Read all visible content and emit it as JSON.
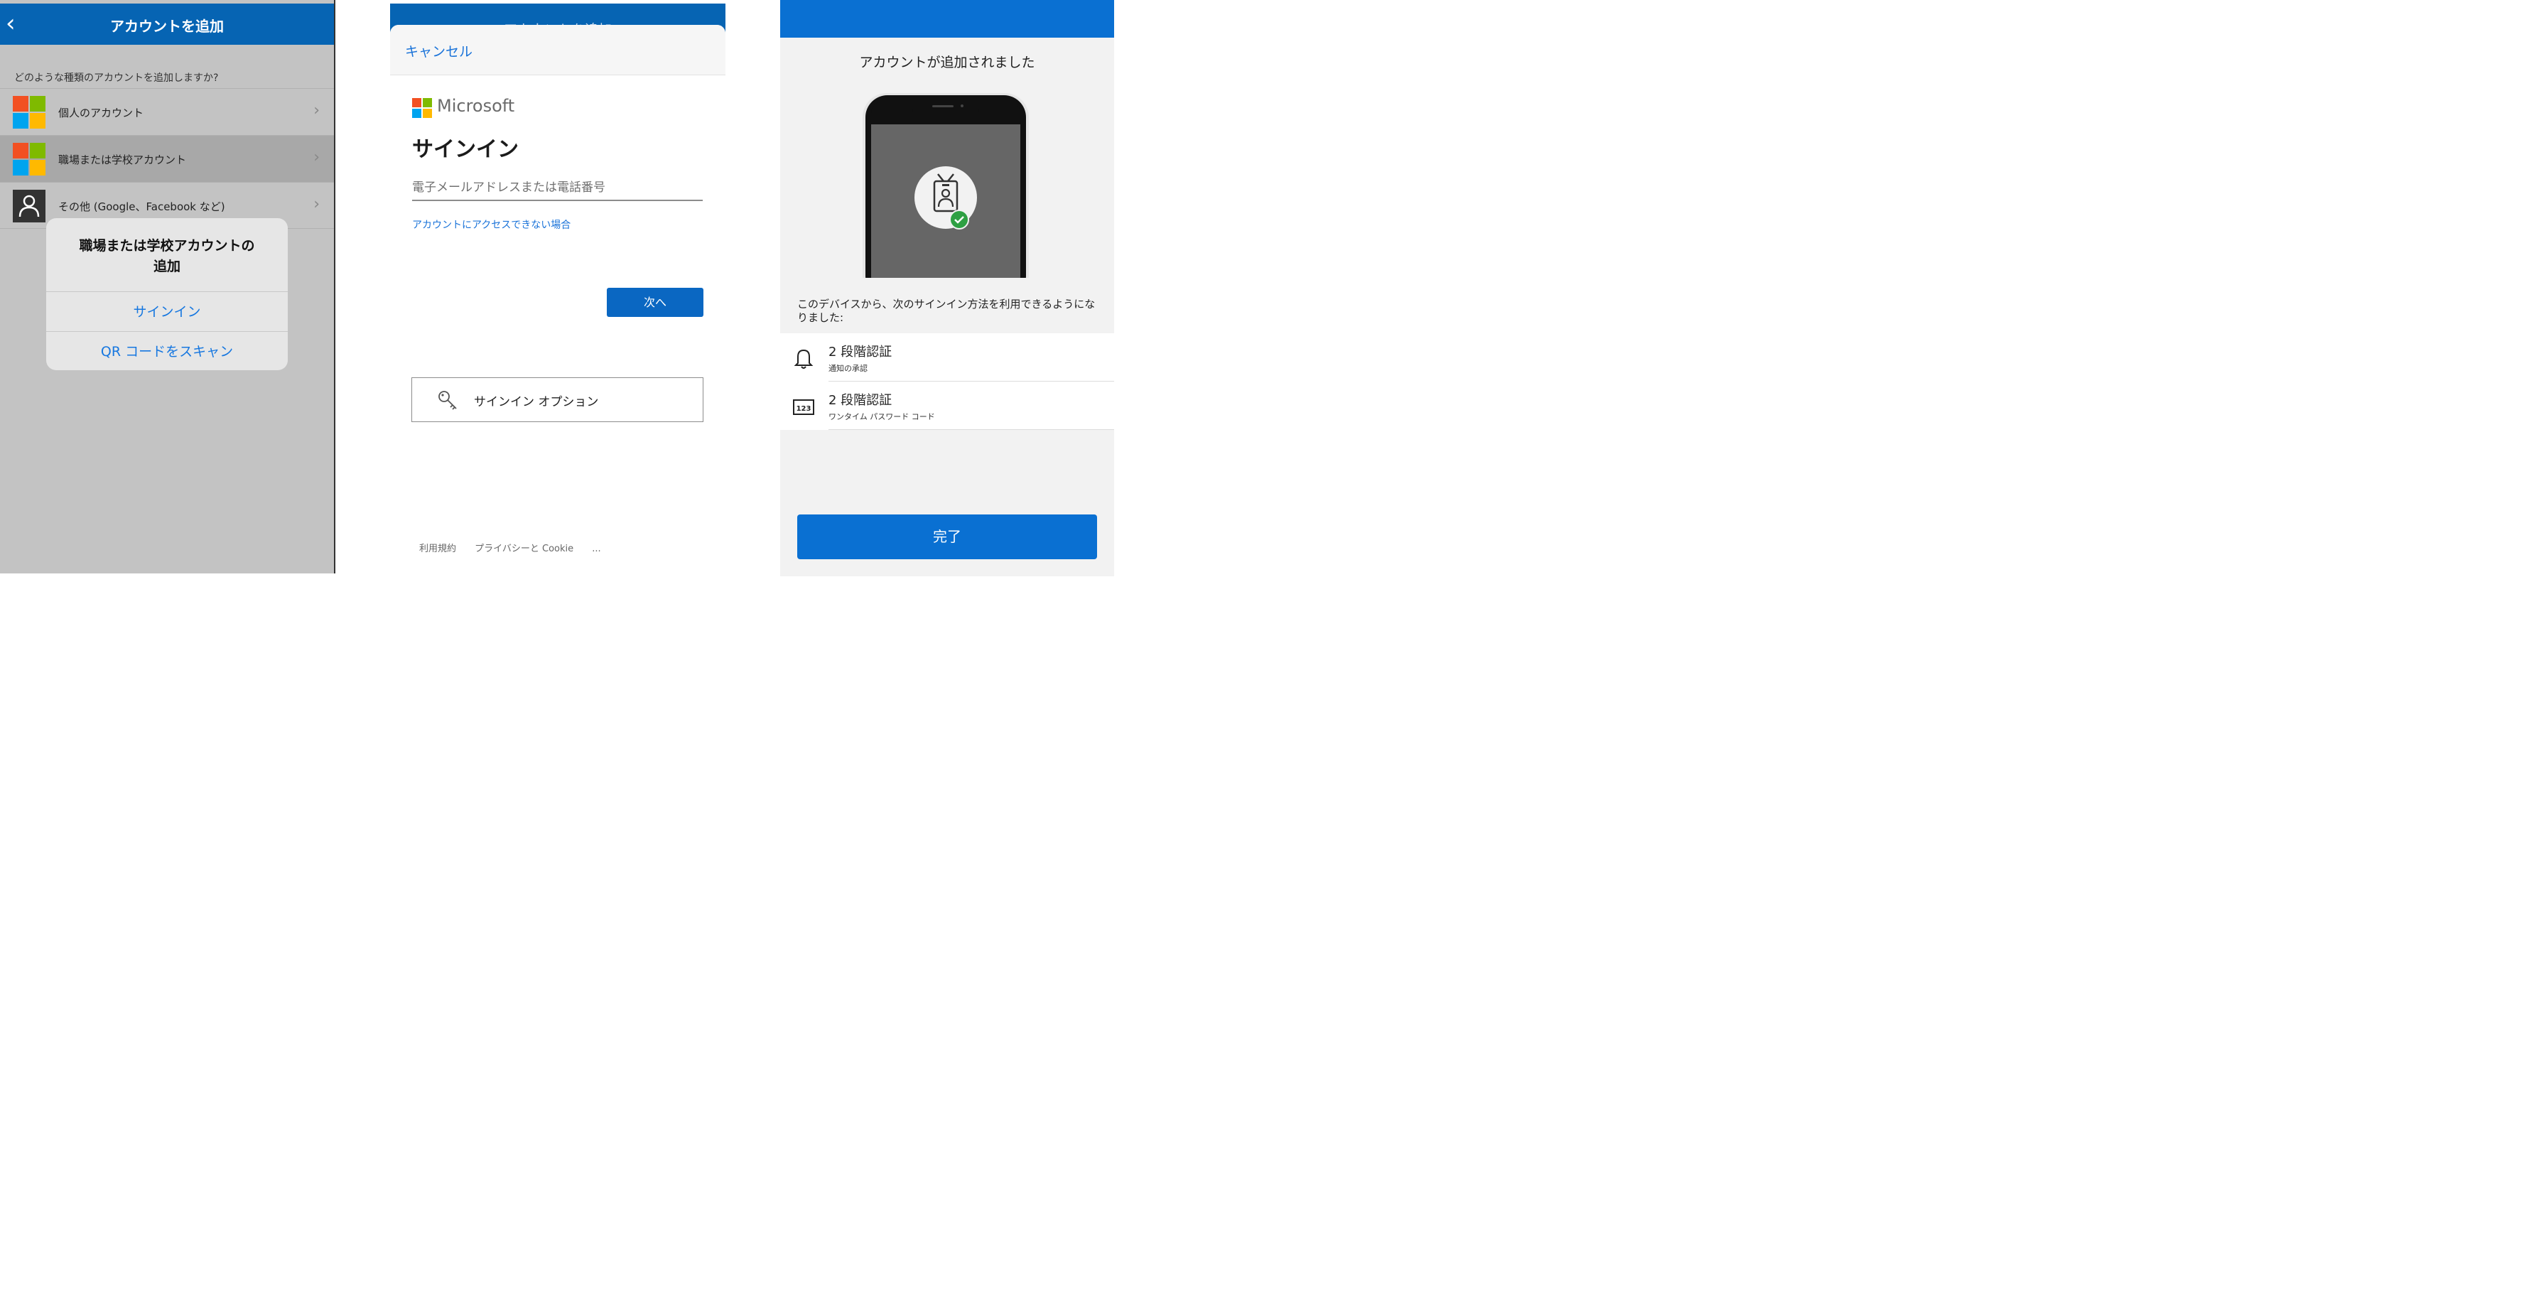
{
  "panel1": {
    "title": "アカウントを追加",
    "back_glyph": "‹",
    "question": "どのような種類のアカウントを追加しますか?",
    "accounts": [
      {
        "label": "個人のアカウント",
        "icon": "microsoft-logo-icon"
      },
      {
        "label": "職場または学校アカウント",
        "icon": "microsoft-logo-icon"
      },
      {
        "label": "その他 (Google、Facebook など)",
        "icon": "person-icon"
      }
    ],
    "chevron": "›",
    "dialog": {
      "title_line1": "職場または学校アカウントの",
      "title_line2": "追加",
      "signin": "サインイン",
      "scan_qr": "QR コードをスキャン"
    }
  },
  "panel2": {
    "header_ghost": "アカウントを追加",
    "cancel": "キャンセル",
    "brand": "Microsoft",
    "heading": "サインイン",
    "email_placeholder": "電子メールアドレスまたは電話番号",
    "no_access_link": "アカウントにアクセスできない場合",
    "next_button": "次へ",
    "signin_options": "サインイン オプション",
    "footer": {
      "terms": "利用規約",
      "privacy": "プライバシーと Cookie",
      "more": "..."
    }
  },
  "panel3": {
    "heading": "アカウントが追加されました",
    "description": "このデバイスから、次のサインイン方法を利用できるようになりました:",
    "methods": [
      {
        "title": "2 段階認証",
        "subtitle": "通知の承認",
        "icon": "bell-icon"
      },
      {
        "title": "2 段階認証",
        "subtitle": "ワンタイム パスワード コード",
        "icon": "code-123-icon",
        "icon_text": "123"
      }
    ],
    "done_button": "完了"
  },
  "colors": {
    "header_blue": "#0664b3",
    "link_blue": "#1a73d9",
    "button_blue": "#0a70d2",
    "ms_red": "#f25022",
    "ms_green": "#7fba00",
    "ms_blue": "#00a4ef",
    "ms_yellow": "#ffb900",
    "success_green": "#2ea043"
  }
}
